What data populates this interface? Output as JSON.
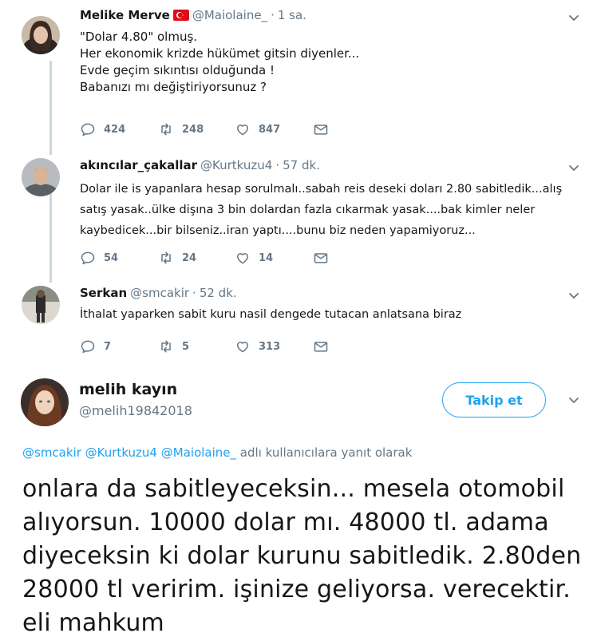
{
  "tweets": [
    {
      "name": "Melike Merve",
      "handle": "@Maiolaine_",
      "time": "1 sa.",
      "flag": "turkey-flag",
      "lines": [
        "\"Dolar 4.80\" olmuş.",
        "Her ekonomik krizde hükümet gitsin diyenler...",
        "Evde geçim sıkıntısı olduğunda !",
        "Babanızı mı değiştiriyorsunuz ?"
      ],
      "replies": "424",
      "retweets": "248",
      "likes": "847"
    },
    {
      "name": "akıncılar_çakallar",
      "handle": "@Kurtkuzu4",
      "time": "57 dk.",
      "lines": [
        "Dolar ile is yapanlara hesap sorulmalı..sabah reis deseki doları 2.80 sabitledik...alış",
        "satış yasak..ülke dişına 3 bin dolardan fazla cıkarmak yasak....bak kimler neler",
        "kaybedicek...bir bilseniz..iran yaptı....bunu biz neden yapamiyoruz..."
      ],
      "replies": "54",
      "retweets": "24",
      "likes": "14"
    },
    {
      "name": "Serkan",
      "handle": "@smcakir",
      "time": "52 dk.",
      "lines": [
        "İthalat yaparken sabit kuru nasil dengede tutacan anlatsana biraz"
      ],
      "replies": "7",
      "retweets": "5",
      "likes": "313"
    }
  ],
  "focused": {
    "name": "melih kayın",
    "handle": "@melih19842018",
    "follow_label": "Takip et",
    "reply_mentions": [
      "@smcakir",
      "@Kurtkuzu4",
      "@Maiolaine_"
    ],
    "reply_suffix": "adlı kullanıcılara yanıt olarak",
    "lines": [
      "onlara da sabitleyeceksin... mesela otomobil",
      "alıyorsun. 10000 dolar mı. 48000 tl. adama",
      "diyeceksin ki dolar kurunu sabitledik. 2.80den",
      "28000 tl veririm. işinize geliyorsa. verecektir.",
      "eli mahkum"
    ]
  },
  "colors": {
    "accent": "#1da1f2",
    "muted": "#657786",
    "thread_line": "#ccd6dd",
    "text": "#14171a"
  }
}
